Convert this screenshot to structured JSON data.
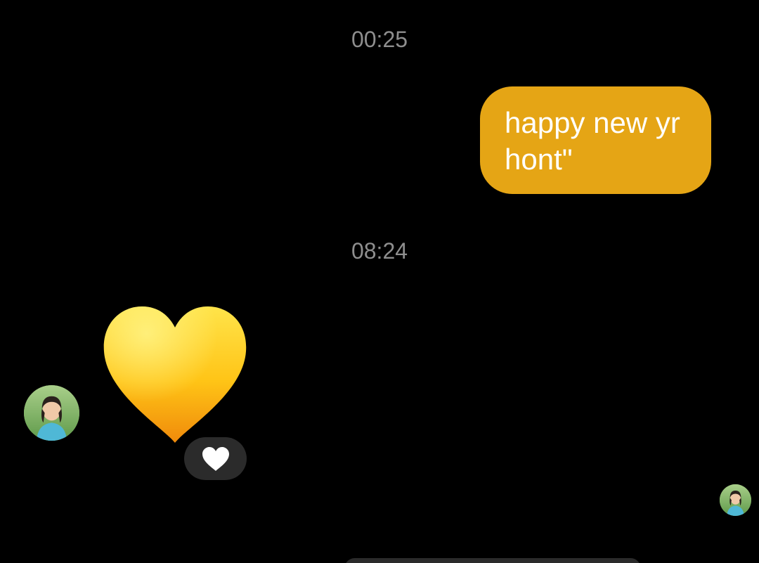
{
  "thread": {
    "timestamps": [
      "00:25",
      "08:24"
    ],
    "messages": [
      {
        "direction": "outgoing",
        "text": "happy new yr\nhont\"",
        "bubble_color": "#e5a515"
      },
      {
        "direction": "incoming",
        "emoji": "yellow-heart-emoji",
        "reaction": "white-heart-icon"
      }
    ]
  },
  "colors": {
    "background": "#000000",
    "timestamp_text": "#8e8e8e",
    "reaction_pill": "#2b2b2b"
  }
}
